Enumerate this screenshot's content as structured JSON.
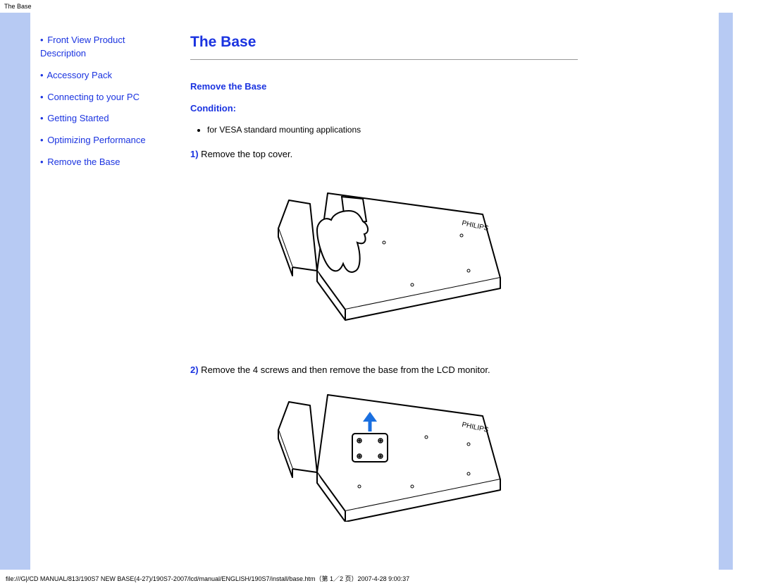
{
  "window_title": "The Base",
  "sidebar": {
    "items": [
      {
        "label": "Front View Product Description"
      },
      {
        "label": "Accessory Pack"
      },
      {
        "label": "Connecting to your PC"
      },
      {
        "label": "Getting Started"
      },
      {
        "label": "Optimizing Performance"
      },
      {
        "label": "Remove the Base"
      }
    ]
  },
  "main": {
    "title": "The Base",
    "section1_title": "Remove the Base",
    "section2_title": "Condition:",
    "condition_bullet": "for VESA standard mounting applications",
    "step1_num": "1)",
    "step1_text": " Remove the top cover.",
    "step2_num": "2)",
    "step2_text": " Remove the 4 screws and then remove the base from the LCD monitor."
  },
  "footer": "file:///G|/CD MANUAL/813/190S7 NEW BASE(4-27)/190S7-2007/lcd/manual/ENGLISH/190S7/install/base.htm（第 1／2 页）2007-4-28 9:00:37"
}
